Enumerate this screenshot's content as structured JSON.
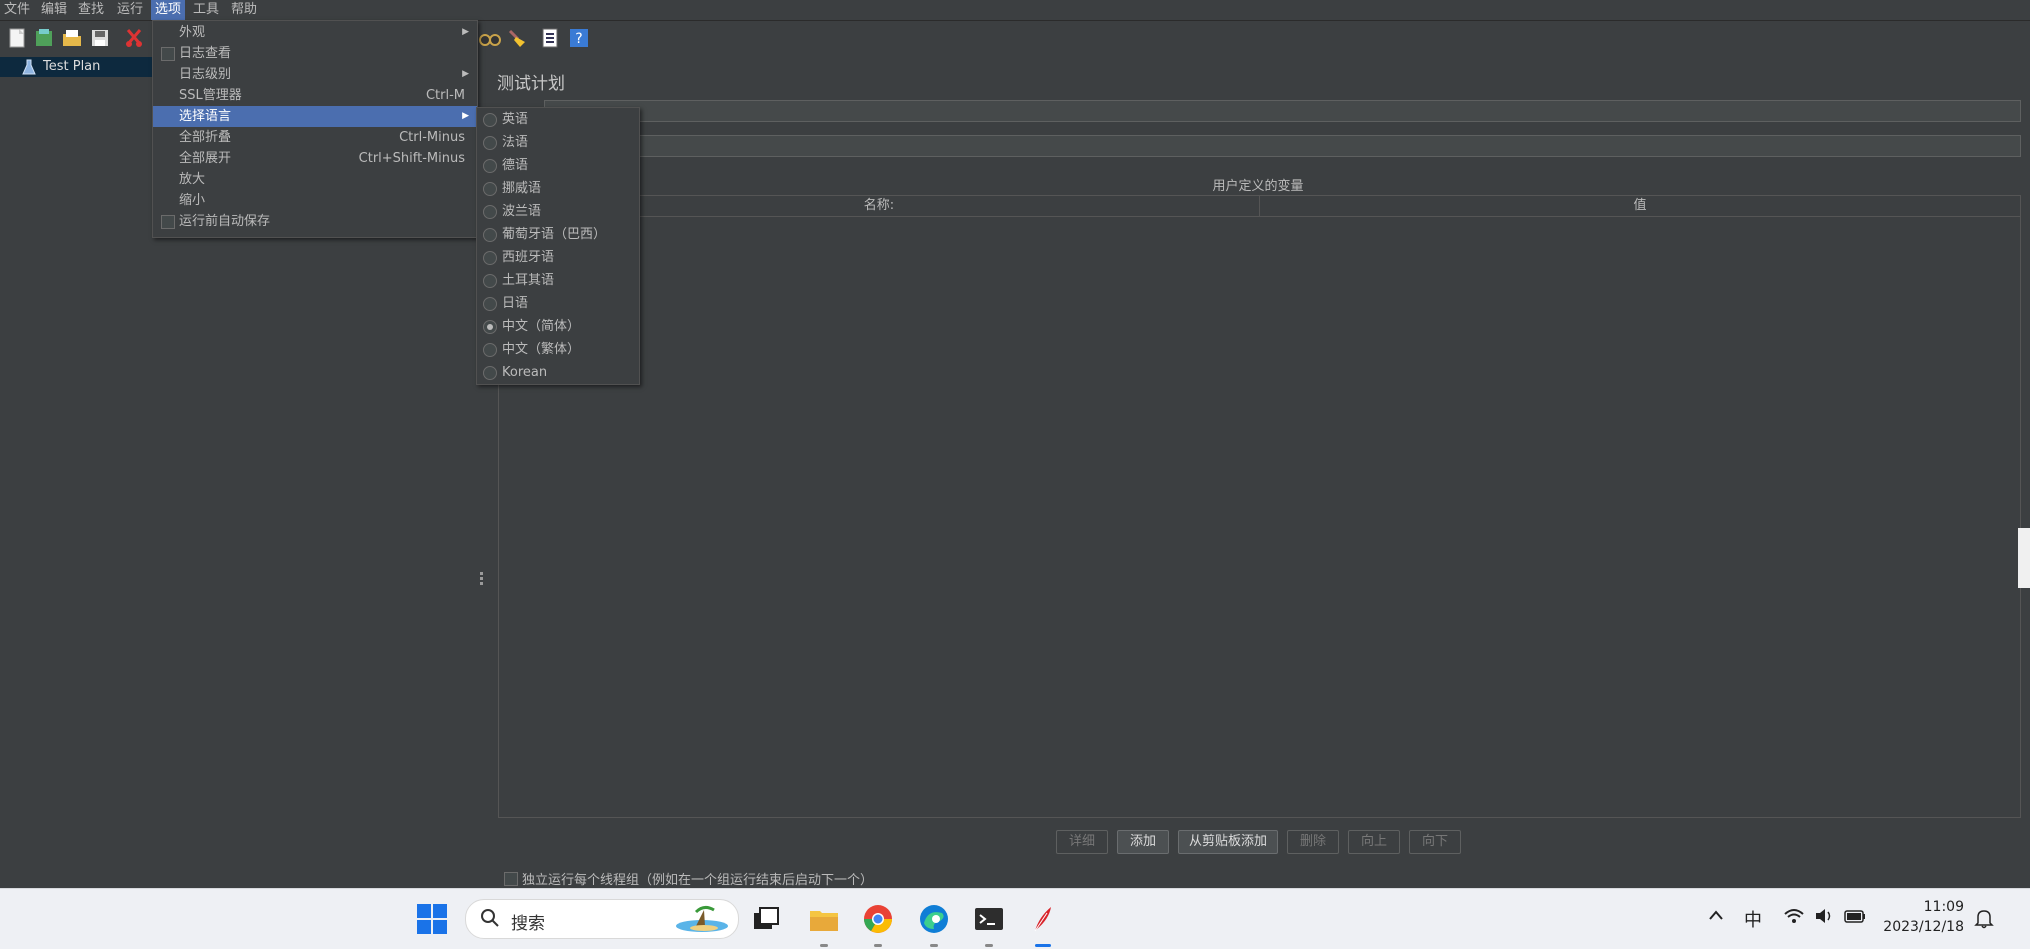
{
  "menubar": {
    "items": [
      "文件",
      "编辑",
      "查找",
      "运行",
      "选项",
      "工具",
      "帮助"
    ],
    "active": "选项"
  },
  "toolbar": {
    "icons": [
      "new-icon",
      "templates-icon",
      "open-icon",
      "save-icon",
      "cut-icon",
      "search-binoculars-icon",
      "clear-broom-icon",
      "function-helper-icon",
      "help-icon"
    ]
  },
  "tree": {
    "items": [
      {
        "label": "Test Plan",
        "icon": "flask-icon",
        "selected": true
      }
    ]
  },
  "options_menu": {
    "items": [
      {
        "label": "外观",
        "shortcut": "",
        "submenu": true,
        "checkbox": false
      },
      {
        "label": "日志查看",
        "shortcut": "",
        "submenu": false,
        "checkbox": true
      },
      {
        "label": "日志级别",
        "shortcut": "",
        "submenu": true,
        "checkbox": false
      },
      {
        "label": "SSL管理器",
        "shortcut": "Ctrl-M",
        "submenu": false,
        "checkbox": false
      },
      {
        "label": "选择语言",
        "shortcut": "",
        "submenu": true,
        "checkbox": false,
        "highlighted": true
      },
      {
        "label": "全部折叠",
        "shortcut": "Ctrl-Minus",
        "submenu": false,
        "checkbox": false
      },
      {
        "label": "全部展开",
        "shortcut": "Ctrl+Shift-Minus",
        "submenu": false,
        "checkbox": false
      },
      {
        "label": "放大",
        "shortcut": "",
        "submenu": false,
        "checkbox": false
      },
      {
        "label": "缩小",
        "shortcut": "",
        "submenu": false,
        "checkbox": false
      },
      {
        "label": "运行前自动保存",
        "shortcut": "",
        "submenu": false,
        "checkbox": true
      }
    ]
  },
  "language_menu": {
    "items": [
      {
        "label": "英语",
        "selected": false
      },
      {
        "label": "法语",
        "selected": false
      },
      {
        "label": "德语",
        "selected": false
      },
      {
        "label": "挪威语",
        "selected": false
      },
      {
        "label": "波兰语",
        "selected": false
      },
      {
        "label": "葡萄牙语（巴西）",
        "selected": false
      },
      {
        "label": "西班牙语",
        "selected": false
      },
      {
        "label": "土耳其语",
        "selected": false
      },
      {
        "label": "日语",
        "selected": false
      },
      {
        "label": "中文（简体）",
        "selected": true
      },
      {
        "label": "中文（繁体）",
        "selected": false
      },
      {
        "label": "Korean",
        "selected": false
      }
    ]
  },
  "panel": {
    "title": "测试计划",
    "name_value": "",
    "comment_value": "",
    "user_vars_title": "用户定义的变量",
    "columns": [
      "名称:",
      "值"
    ],
    "buttons": [
      {
        "label": "详细",
        "enabled": false
      },
      {
        "label": "添加",
        "enabled": true
      },
      {
        "label": "从剪贴板添加",
        "enabled": true
      },
      {
        "label": "删除",
        "enabled": false
      },
      {
        "label": "向上",
        "enabled": false
      },
      {
        "label": "向下",
        "enabled": false
      }
    ],
    "independent_threads_label": "独立运行每个线程组（例如在一个组运行结束后启动下一个）"
  },
  "taskbar": {
    "search_placeholder": "搜索",
    "ime": "中",
    "time": "11:09",
    "date": "2023/12/18",
    "apps": [
      "start-icon",
      "task-view-icon",
      "file-explorer-icon",
      "chrome-icon",
      "edge-icon",
      "terminal-icon",
      "jmeter-feather-icon"
    ]
  },
  "colors": {
    "background": "#3c3f41",
    "highlight": "#4b6eaf",
    "taskbar": "#eef0f4"
  }
}
